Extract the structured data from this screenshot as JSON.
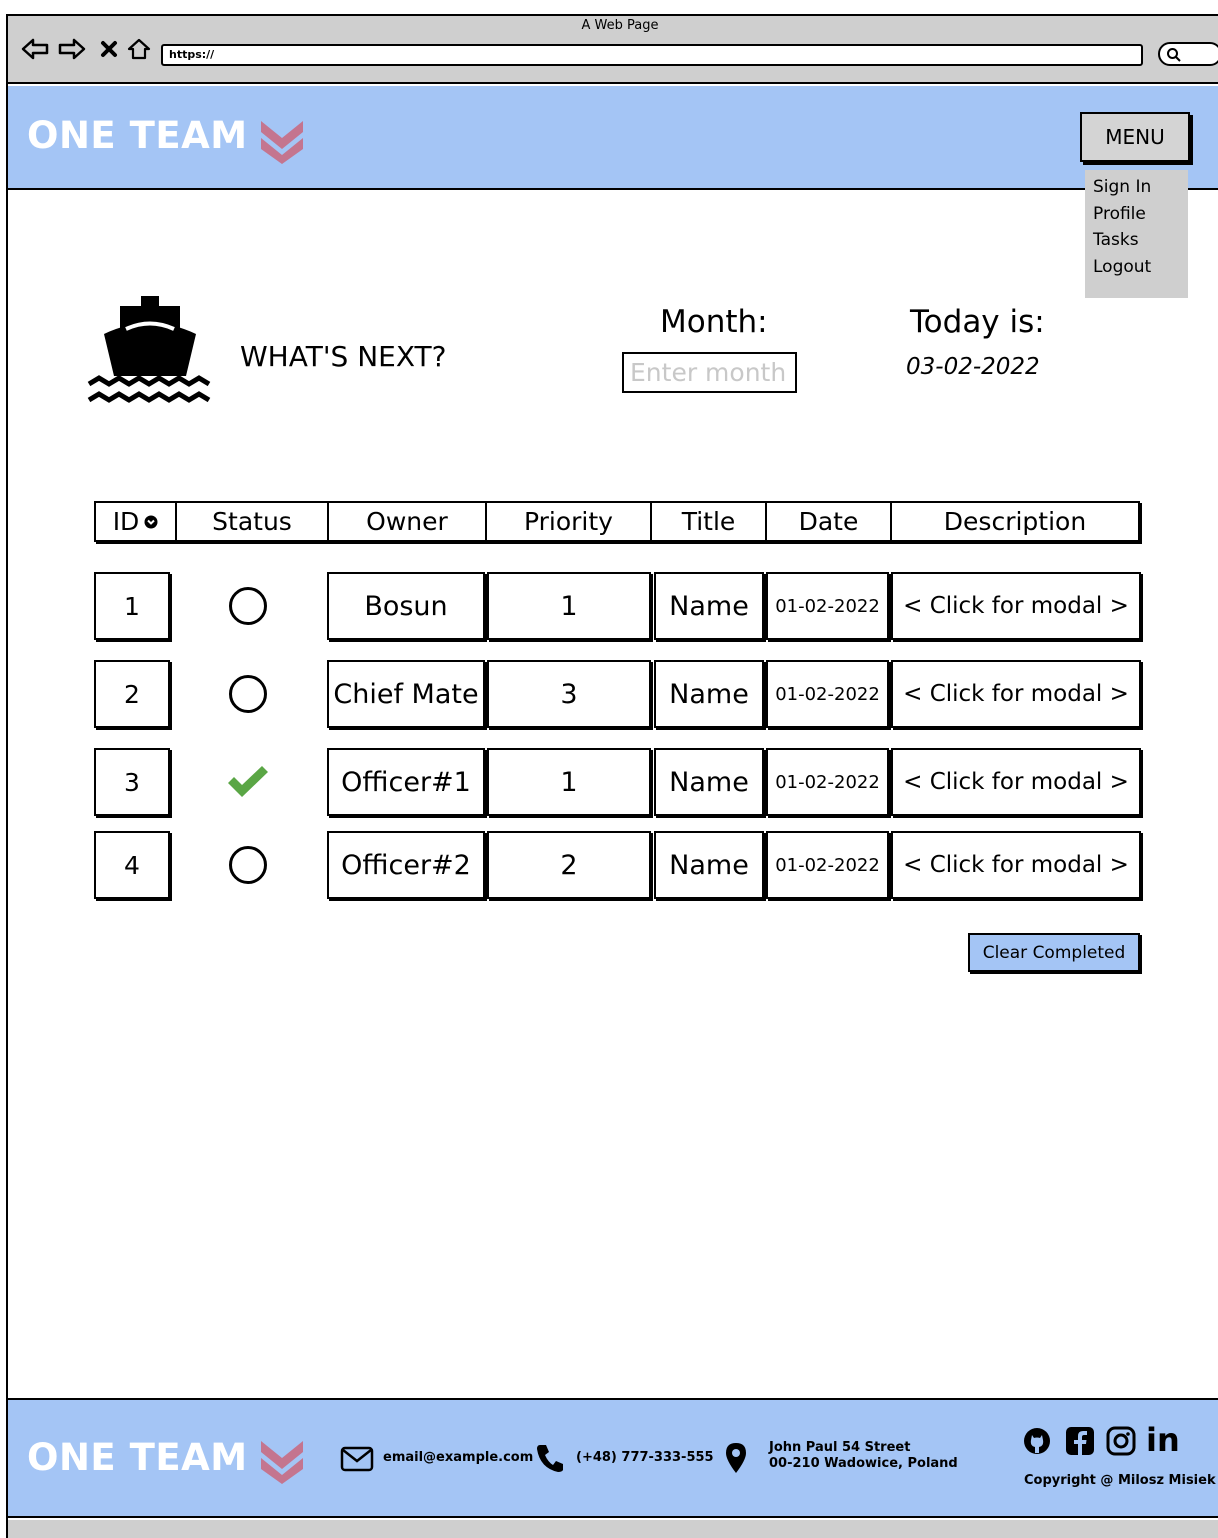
{
  "browser": {
    "title": "A Web Page",
    "url": "https://"
  },
  "header": {
    "logo": "ONE TEAM",
    "menu_label": "MENU",
    "menu_items": [
      "Sign In",
      "Profile",
      "Tasks",
      "Logout"
    ]
  },
  "toolbar": {
    "heading": "WHAT'S NEXT?",
    "month_label": "Month:",
    "month_placeholder": "Enter month",
    "today_label": "Today is:",
    "today_value": "03-02-2022"
  },
  "table": {
    "columns": [
      "ID",
      "Status",
      "Owner",
      "Priority",
      "Title",
      "Date",
      "Description"
    ],
    "rows": [
      {
        "id": "1",
        "status": "open",
        "owner": "Bosun",
        "priority": "1",
        "title": "Name",
        "date": "01-02-2022",
        "description": "< Click for modal >"
      },
      {
        "id": "2",
        "status": "open",
        "owner": "Chief Mate",
        "priority": "3",
        "title": "Name",
        "date": "01-02-2022",
        "description": "< Click for modal >"
      },
      {
        "id": "3",
        "status": "done",
        "owner": "Officer#1",
        "priority": "1",
        "title": "Name",
        "date": "01-02-2022",
        "description": "< Click for modal >"
      },
      {
        "id": "4",
        "status": "open",
        "owner": "Officer#2",
        "priority": "2",
        "title": "Name",
        "date": "01-02-2022",
        "description": "< Click for modal >"
      }
    ]
  },
  "actions": {
    "clear_completed": "Clear Completed"
  },
  "footer": {
    "logo": "ONE TEAM",
    "email": "email@example.com",
    "phone": "(+48) 777-333-555",
    "address_line1": "John Paul 54 Street",
    "address_line2": "00-210 Wadowice, Poland",
    "copyright": "Copyright @ Milosz Misiek",
    "social": [
      "github-icon",
      "facebook-icon",
      "instagram-icon",
      "linkedin-icon"
    ]
  },
  "colors": {
    "header_bg": "#a4c5f5",
    "accent_chevron": "#c4758f",
    "done_check": "#5aa645",
    "chrome_gray": "#cfcfcf"
  }
}
